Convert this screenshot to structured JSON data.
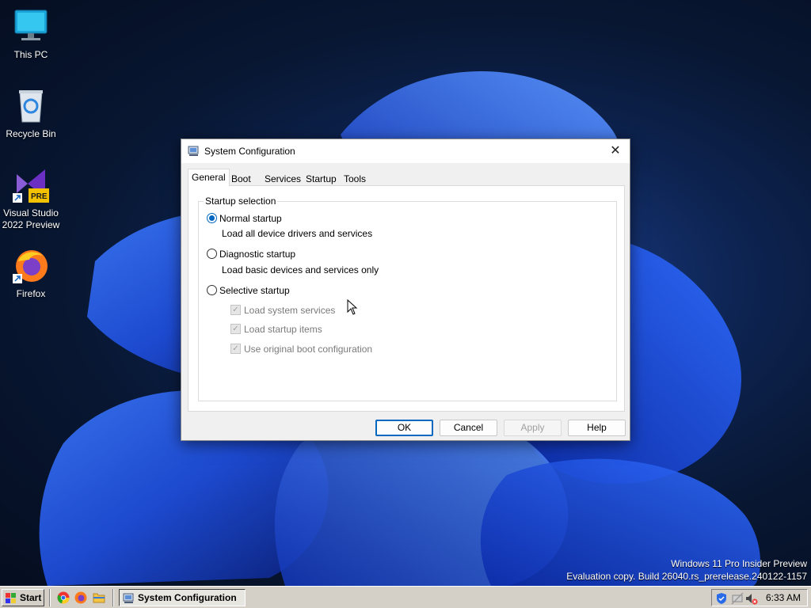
{
  "desktop": {
    "icons": [
      {
        "label_line1": "This PC",
        "label_line2": ""
      },
      {
        "label_line1": "Recycle Bin",
        "label_line2": ""
      },
      {
        "label_line1": "Visual Studio",
        "label_line2": "2022 Preview",
        "badge": "PRE"
      },
      {
        "label_line1": "Firefox",
        "label_line2": ""
      }
    ],
    "watermark": {
      "line1": "Windows 11 Pro Insider Preview",
      "line2": "Evaluation copy. Build 26040.rs_prerelease.240122-1157"
    }
  },
  "dialog": {
    "title": "System Configuration",
    "close_glyph": "✕",
    "tabs": [
      "General",
      "Boot",
      "Services",
      "Startup",
      "Tools"
    ],
    "active_tab": "General",
    "group_title": "Startup selection",
    "options": [
      {
        "label": "Normal startup",
        "description": "Load all device drivers and services",
        "selected": true
      },
      {
        "label": "Diagnostic startup",
        "description": "Load basic devices and services only",
        "selected": false
      },
      {
        "label": "Selective startup",
        "description": "",
        "selected": false
      }
    ],
    "selective_items": [
      {
        "label": "Load system services",
        "checked": true,
        "enabled": false
      },
      {
        "label": "Load startup items",
        "checked": true,
        "enabled": false
      },
      {
        "label": "Use original boot configuration",
        "checked": true,
        "enabled": false
      }
    ],
    "buttons": {
      "ok": "OK",
      "cancel": "Cancel",
      "apply": "Apply",
      "help": "Help"
    }
  },
  "taskbar": {
    "start_label": "Start",
    "quicklaunch": [
      "chrome-icon",
      "firefox-icon",
      "file-explorer-icon"
    ],
    "task_button_label": "System Configuration",
    "clock": "6:33 AM"
  },
  "colors": {
    "accent": "#0067c0",
    "taskbar": "#d4d0c8",
    "desktop": "#0d2350"
  }
}
